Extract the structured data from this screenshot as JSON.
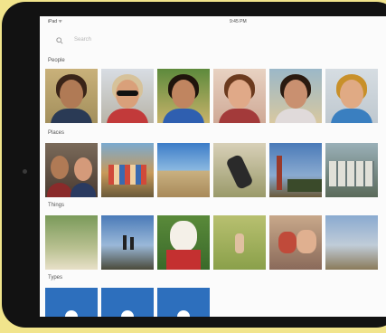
{
  "status_bar": {
    "carrier": "iPad ᯤ",
    "time": "9:45 PM"
  },
  "search": {
    "placeholder": "Search"
  },
  "sections": {
    "people": "People",
    "places": "Places",
    "things": "Things",
    "types": "Types"
  },
  "colors": {
    "accent": "#2d6fbd",
    "frame": "#121212",
    "background": "#f1e48c"
  }
}
